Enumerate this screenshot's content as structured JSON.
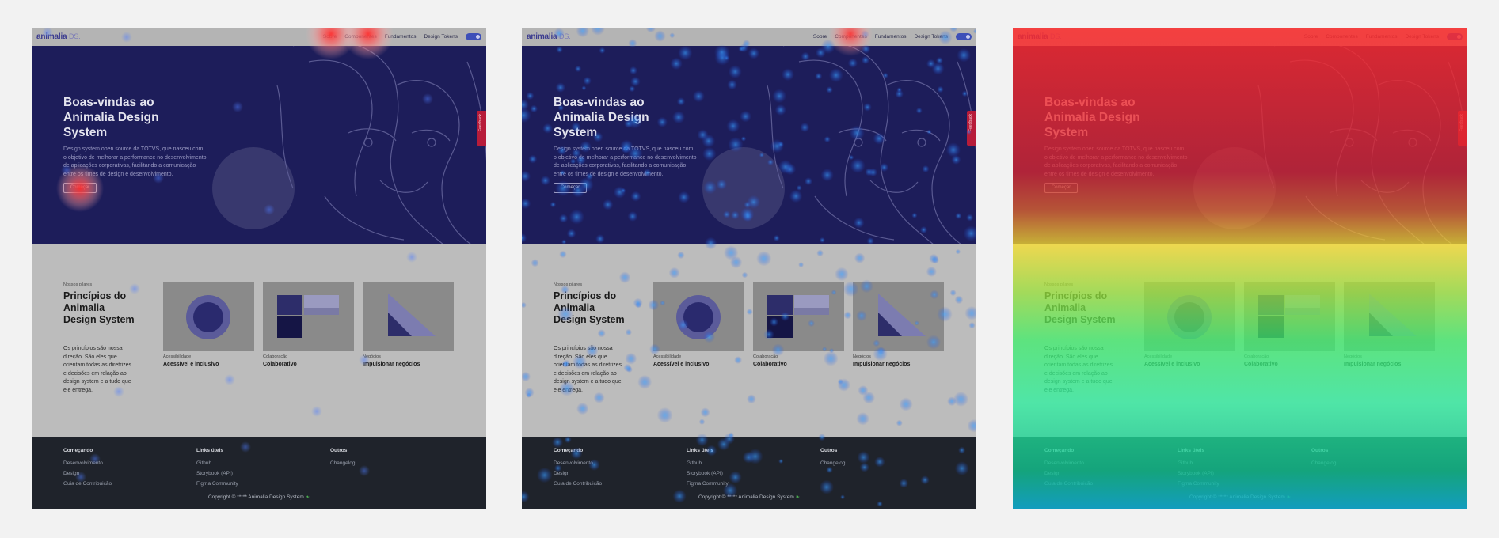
{
  "site": {
    "logo": "animalia",
    "logo_suffix": "DS.",
    "nav": [
      "Sobre",
      "Componentes",
      "Fundamentos",
      "Design Tokens"
    ],
    "feedback_label": "Feedback"
  },
  "hero": {
    "title": "Boas-vindas ao Animalia Design System",
    "description": "Design system open source da TOTVS, que nasceu com o objetivo de melhorar a performance no desenvolvimento de aplicações corporativas, facilitando a comunicação entre os times de design e desenvolvimento.",
    "cta": "Começar"
  },
  "principles": {
    "eyebrow": "Nossos pilares",
    "title": "Princípios do Animalia Design System",
    "text": "Os princípios são nossa direção. São eles que orientam todas as diretrizes e decisões em relação ao design system e a tudo que ele entrega.",
    "cards": [
      {
        "label": "Acessibilidade",
        "title": "Acessível e inclusivo"
      },
      {
        "label": "Colaboração",
        "title": "Colaborativo"
      },
      {
        "label": "Negócios",
        "title": "Impulsionar negócios"
      }
    ]
  },
  "footer": {
    "columns": [
      {
        "title": "Começando",
        "links": [
          "Desenvolvimento",
          "Design",
          "Guia de Contribuição"
        ]
      },
      {
        "title": "Links úteis",
        "links": [
          "Github",
          "Storybook (API)",
          "Figma Community"
        ]
      },
      {
        "title": "Outros",
        "links": [
          "Changelog"
        ]
      }
    ],
    "copyright": "Copyright © ***** Animalia Design System"
  },
  "colors": {
    "hero_bg": "#1d1d5a",
    "footer_bg": "#1f232b",
    "feedback_tab": "#b71c3a",
    "toggle": "#3d4fb8"
  },
  "panels": [
    {
      "view": "click-map"
    },
    {
      "view": "scroll-heatmap-dots"
    },
    {
      "view": "attention-gradient"
    }
  ]
}
